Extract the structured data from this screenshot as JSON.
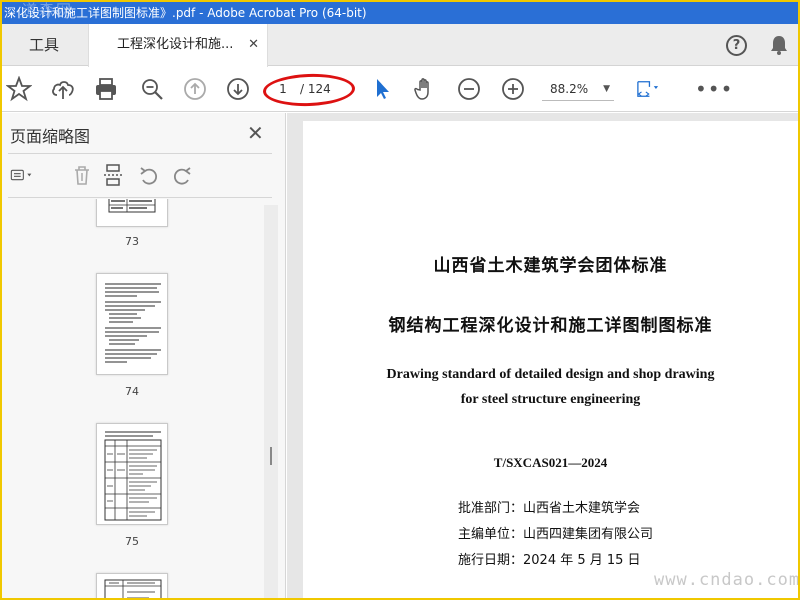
{
  "window": {
    "title": "深化设计和施工详图制图标准》.pdf - Adobe Acrobat Pro (64-bit)",
    "watermark_top": "道森网"
  },
  "tabs": {
    "tools_label": "工具",
    "doc_label": "工程深化设计和施...",
    "close_glyph": "✕"
  },
  "toolbar": {
    "page_current": "1",
    "page_total": "/ 124",
    "zoom": "88.2%",
    "more_glyph": "•••",
    "annotation_color": "#d11111",
    "cursor_color": "#1f6fd1"
  },
  "sidebar": {
    "title": "页面缩略图",
    "close_glyph": "✕",
    "thumbnails": [
      {
        "label": "73"
      },
      {
        "label": "74"
      },
      {
        "label": "75"
      }
    ]
  },
  "document": {
    "title_cn_1": "山西省土木建筑学会团体标准",
    "title_cn_2": "钢结构工程深化设计和施工详图制图标准",
    "title_en_1": "Drawing standard of detailed design and shop drawing",
    "title_en_2": "for steel structure engineering",
    "code": "T/SXCAS021—2024",
    "approval": "批准部门：山西省土木建筑学会",
    "editor": "主编单位：山西四建集团有限公司",
    "effective": "施行日期：2024 年 5 月 15 日"
  },
  "footer_watermark": "www.cndao.com",
  "colors": {
    "titlebar": "#2a6fd6",
    "outer_border": "#f0c800"
  }
}
